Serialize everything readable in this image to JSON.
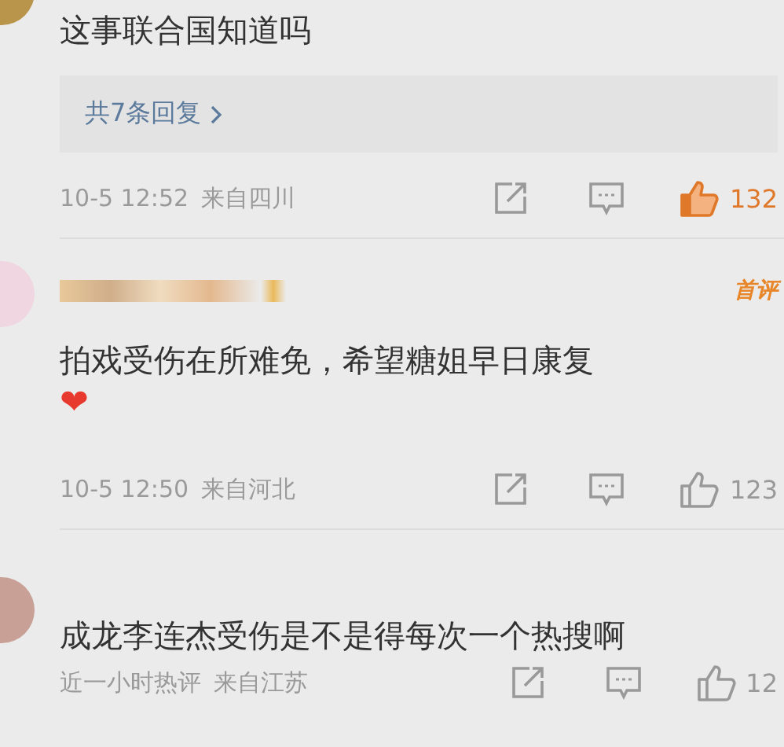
{
  "comments": [
    {
      "show_name": false,
      "text": "这事联合国知道吗",
      "replies": "共7条回复",
      "time": "10-5 12:52",
      "location": "来自四川",
      "liked": true,
      "likes": "132"
    },
    {
      "show_name": true,
      "badge": "首评",
      "text": "拍戏受伤在所难免，希望糖姐早日康复",
      "emoji": "❤",
      "time": "10-5 12:50",
      "location": "来自河北",
      "liked": false,
      "likes": "123"
    },
    {
      "show_name": false,
      "text": "成龙李连杰受伤是不是得每次一个热搜啊",
      "time": "近一小时热评",
      "location": "来自江苏",
      "liked": false,
      "likes": "12"
    }
  ]
}
